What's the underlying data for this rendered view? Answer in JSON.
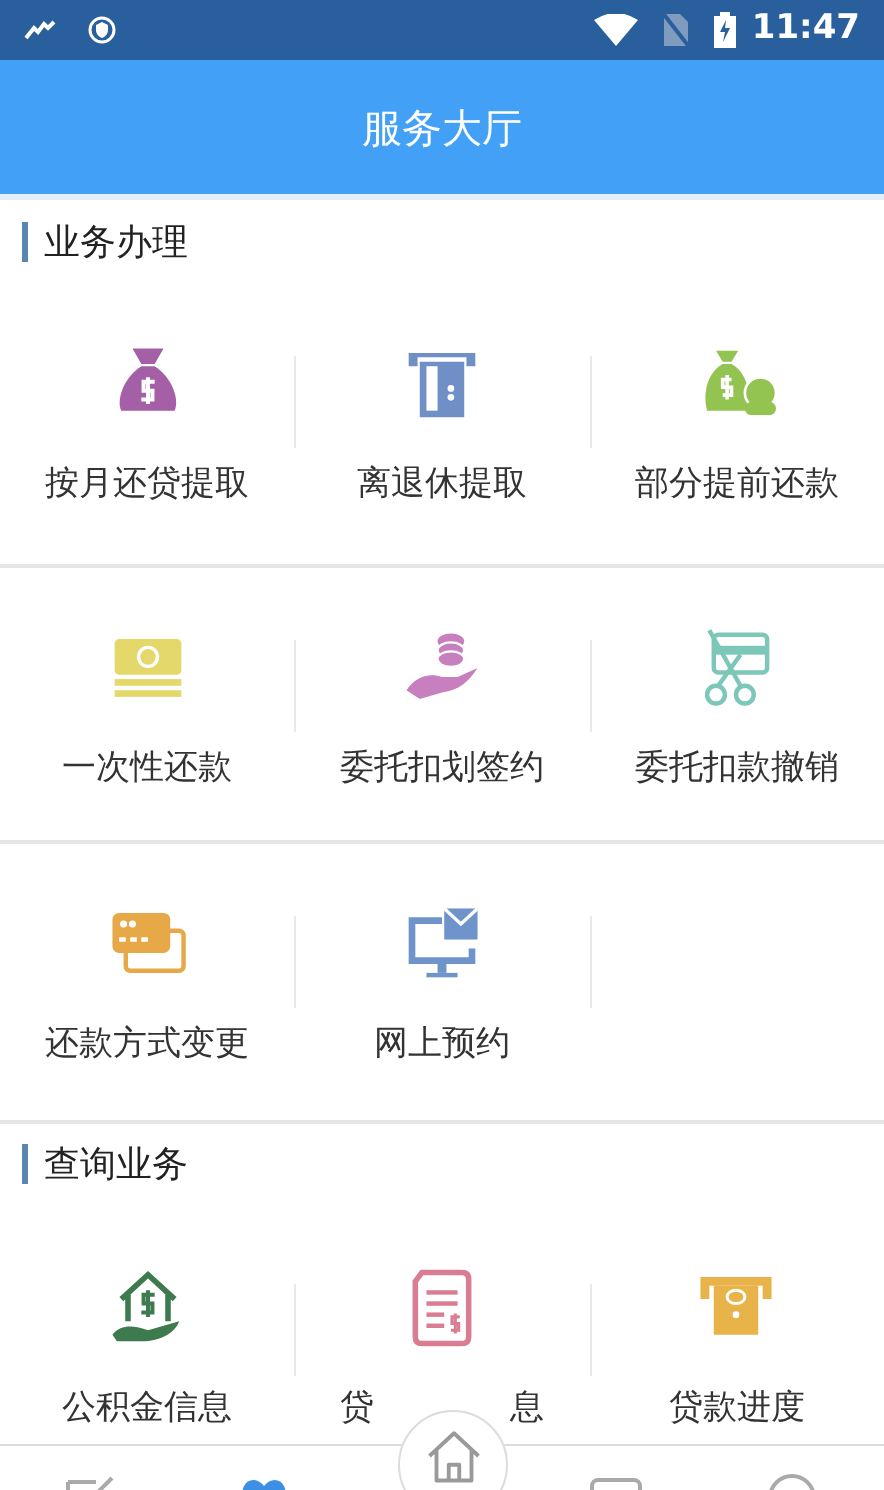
{
  "status_bar": {
    "time": "11:47"
  },
  "title": "服务大厅",
  "sections": [
    {
      "heading": "业务办理",
      "items": [
        {
          "label": "按月还贷提取"
        },
        {
          "label": "离退休提取"
        },
        {
          "label": "部分提前还款"
        },
        {
          "label": "一次性还款"
        },
        {
          "label": "委托扣划签约"
        },
        {
          "label": "委托扣款撤销"
        },
        {
          "label": "还款方式变更"
        },
        {
          "label": "网上预约"
        }
      ]
    },
    {
      "heading": "查询业务",
      "items": [
        {
          "label": "公积金信息"
        },
        {
          "label_parts": [
            "贷",
            "息"
          ]
        },
        {
          "label": "贷款进度"
        }
      ]
    }
  ],
  "bottom_nav": [
    {
      "selected": false
    },
    {
      "selected": true
    },
    {
      "selected": false
    },
    {
      "selected": false
    },
    {
      "selected": false
    }
  ]
}
